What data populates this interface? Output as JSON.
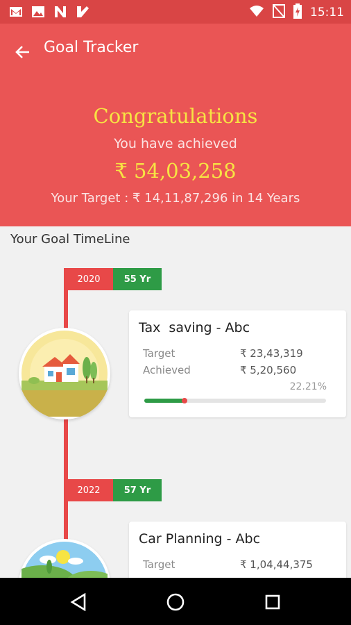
{
  "status_bar": {
    "time": "15:11",
    "left_icons": [
      "gmail-icon",
      "image-icon",
      "n-app-icon",
      "check-app-icon"
    ],
    "right_icons": [
      "wifi-icon",
      "no-signal-icon",
      "battery-charging-icon"
    ]
  },
  "header": {
    "title": "Goal Tracker",
    "congrats": "Congratulations",
    "achieved_label": "You have achieved",
    "achieved_amount": "₹ 54,03,258",
    "target_line": "Your Target : ₹ 14,11,87,296 in 14 Years"
  },
  "timeline": {
    "title": "Your Goal TimeLine",
    "goals": [
      {
        "year": "2020",
        "age": "55 Yr",
        "name": "Tax  saving - Abc",
        "target_label": "Target",
        "target_value": "₹ 23,43,319",
        "achieved_label": "Achieved",
        "achieved_value": "₹ 5,20,560",
        "percent_text": "22.21%",
        "progress": 0.2221,
        "illustration": "house-illustration"
      },
      {
        "year": "2022",
        "age": "57 Yr",
        "name": "Car Planning - Abc",
        "target_label": "Target",
        "target_value": "₹ 1,04,44,375",
        "illustration": "landscape-illustration"
      }
    ]
  },
  "colors": {
    "header_bg": "#ea5555",
    "status_bg": "#d94545",
    "accent_yellow": "#f7e443",
    "timeline_red": "#e84848",
    "age_green": "#2e9b46"
  },
  "nav_bar": {
    "buttons": [
      "back-triangle-icon",
      "home-circle-icon",
      "recents-square-icon"
    ]
  }
}
